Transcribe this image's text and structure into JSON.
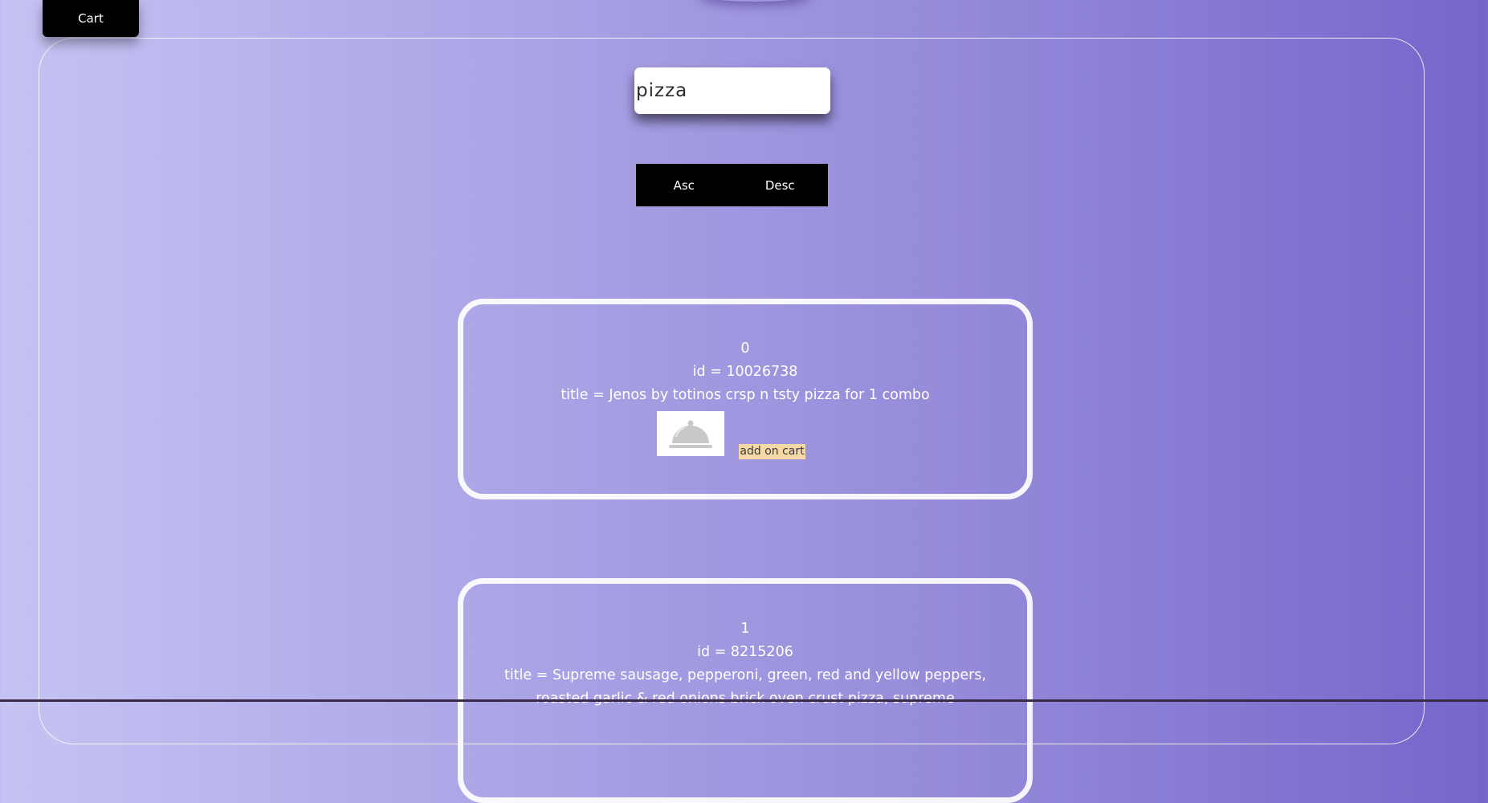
{
  "header": {
    "cart_label": "Cart"
  },
  "search": {
    "value": "pizza",
    "placeholder": ""
  },
  "sort": {
    "asc_label": "Asc",
    "desc_label": "Desc"
  },
  "products": [
    {
      "index": "0",
      "id_text": "id = 10026738",
      "title_text": "title = Jenos by totinos crsp n tsty pizza for 1 combo",
      "image_icon": "serving-dish-icon",
      "add_label": "add on cart"
    },
    {
      "index": "1",
      "id_text": "id = 8215206",
      "title_text": "title = Supreme sausage, pepperoni, green, red and yellow peppers, roasted garlic & red onions brick oven crust pizza, supreme"
    }
  ],
  "colors": {
    "gradient_start": "#c6c3f3",
    "gradient_end": "#7566cb",
    "add_cart_bg": "#f7d9a7",
    "button_bg": "#000000"
  }
}
